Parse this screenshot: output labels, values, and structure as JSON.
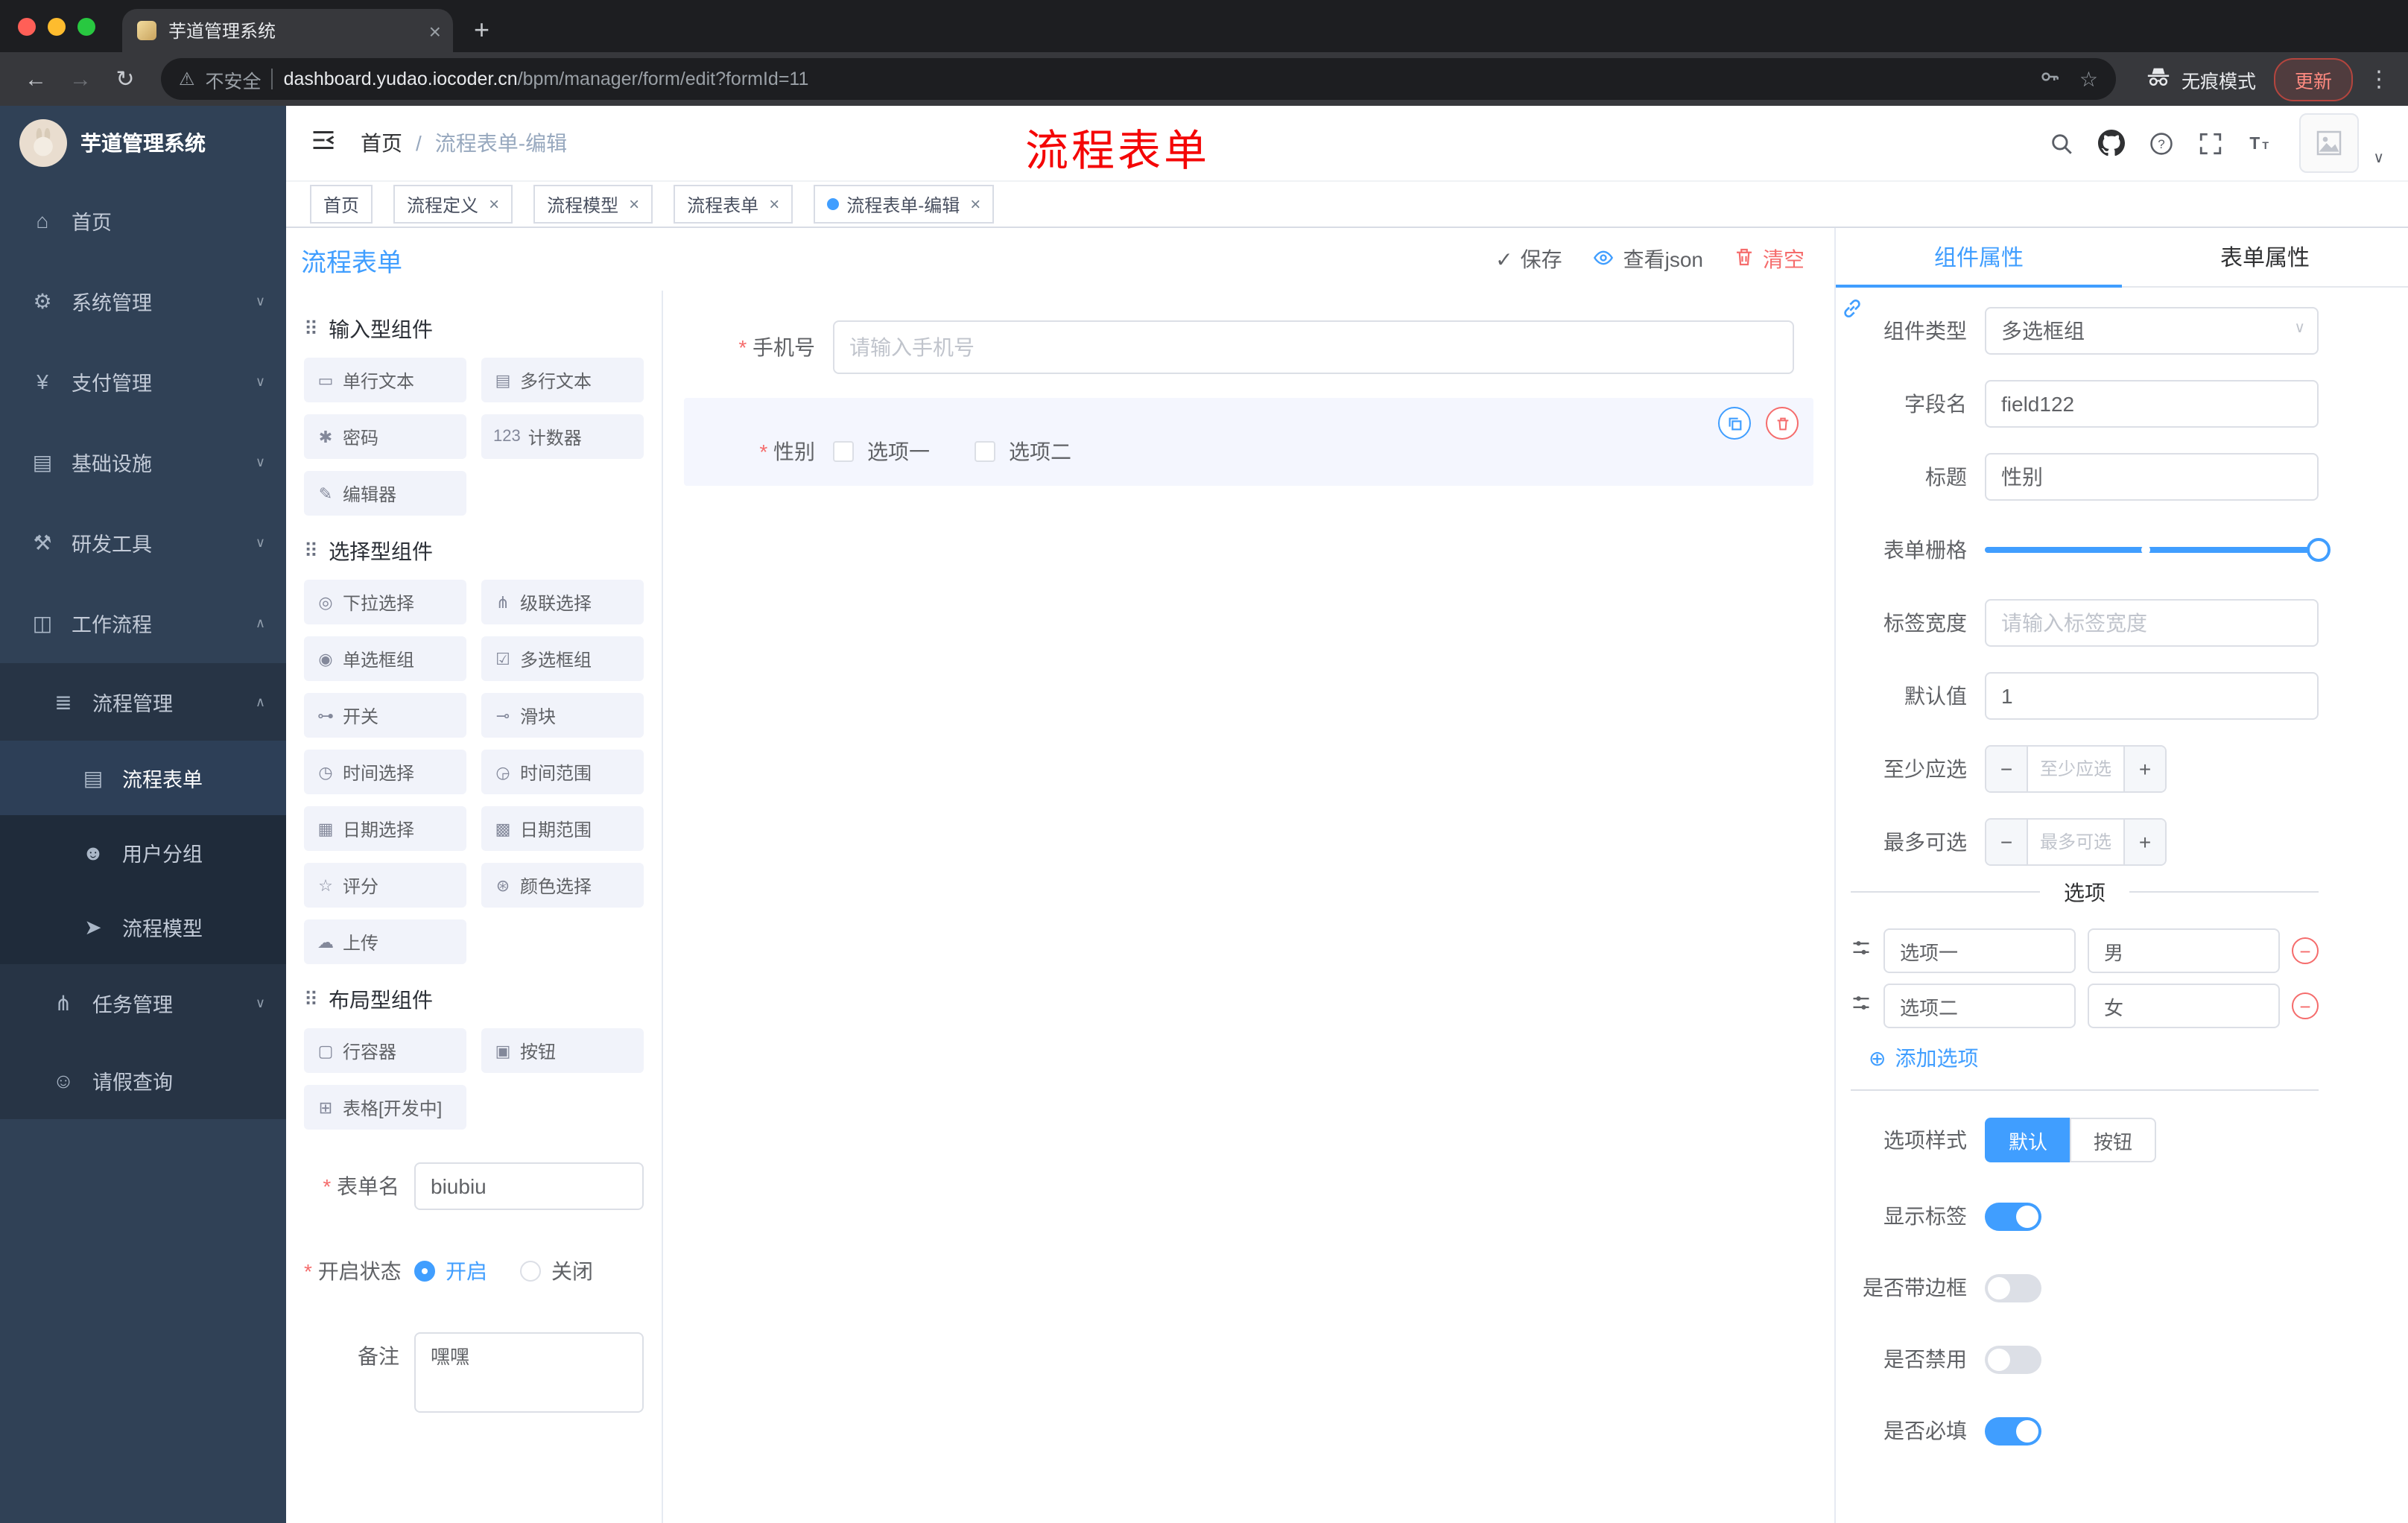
{
  "icons": {
    "chevron_down": "∨",
    "chevron_up": "∧",
    "close": "×",
    "plus": "+",
    "minus": "−",
    "warning": "⚠",
    "star_outline": "☆",
    "kebab": "⋮",
    "back_arrow": "←",
    "forward_arrow": "→",
    "reload": "↻",
    "check": "✓",
    "add_circle": "⊕",
    "grip": "⠿",
    "new_tab": "+"
  },
  "browser": {
    "tab_title": "芋道管理系统",
    "security_label": "不安全",
    "url_host": "dashboard.yudao.iocoder.cn",
    "url_path": "/bpm/manager/form/edit?formId=11",
    "incognito_label": "无痕模式",
    "update_label": "更新"
  },
  "sidebar": {
    "logo_title": "芋道管理系统",
    "items": [
      {
        "icon": "⌂",
        "label": "首页"
      },
      {
        "icon": "⚙",
        "label": "系统管理"
      },
      {
        "icon": "¥",
        "label": "支付管理"
      },
      {
        "icon": "▤",
        "label": "基础设施"
      },
      {
        "icon": "⚒",
        "label": "研发工具"
      },
      {
        "icon": "◫",
        "label": "工作流程"
      }
    ],
    "process_mgmt": {
      "icon": "≣",
      "label": "流程管理"
    },
    "process_children": [
      {
        "icon": "▤",
        "label": "流程表单"
      },
      {
        "icon": "☻",
        "label": "用户分组"
      },
      {
        "icon": "➤",
        "label": "流程模型"
      }
    ],
    "task_mgmt": {
      "icon": "⋔",
      "label": "任务管理"
    },
    "leave_query": {
      "icon": "☺",
      "label": "请假查询"
    }
  },
  "header": {
    "breadcrumb_home": "首页",
    "breadcrumb_sep": "/",
    "breadcrumb_current": "流程表单-编辑",
    "annotation": "流程表单"
  },
  "tags": [
    {
      "label": "首页"
    },
    {
      "label": "流程定义"
    },
    {
      "label": "流程模型"
    },
    {
      "label": "流程表单"
    },
    {
      "label": "流程表单-编辑"
    }
  ],
  "designer": {
    "panel_title": "流程表单",
    "save_label": "保存",
    "view_json_label": "查看json",
    "clear_label": "清空",
    "sections": [
      {
        "title": "输入型组件",
        "items": [
          {
            "icon": "▭",
            "label": "单行文本"
          },
          {
            "icon": "▤",
            "label": "多行文本"
          },
          {
            "icon": "✱",
            "label": "密码"
          },
          {
            "icon": "123",
            "label": "计数器"
          },
          {
            "icon": "✎",
            "label": "编辑器"
          }
        ]
      },
      {
        "title": "选择型组件",
        "items": [
          {
            "icon": "◎",
            "label": "下拉选择"
          },
          {
            "icon": "⋔",
            "label": "级联选择"
          },
          {
            "icon": "◉",
            "label": "单选框组"
          },
          {
            "icon": "☑",
            "label": "多选框组"
          },
          {
            "icon": "⊶",
            "label": "开关"
          },
          {
            "icon": "⊸",
            "label": "滑块"
          },
          {
            "icon": "◷",
            "label": "时间选择"
          },
          {
            "icon": "◶",
            "label": "时间范围"
          },
          {
            "icon": "▦",
            "label": "日期选择"
          },
          {
            "icon": "▩",
            "label": "日期范围"
          },
          {
            "icon": "☆",
            "label": "评分"
          },
          {
            "icon": "⊛",
            "label": "颜色选择"
          },
          {
            "icon": "☁",
            "label": "上传"
          }
        ]
      },
      {
        "title": "布局型组件",
        "items": [
          {
            "icon": "▢",
            "label": "行容器"
          },
          {
            "icon": "▣",
            "label": "按钮"
          },
          {
            "icon": "⊞",
            "label": "表格[开发中]"
          }
        ]
      }
    ],
    "form_name_label": "表单名",
    "form_name_value": "biubiu",
    "status_label": "开启状态",
    "status_on": "开启",
    "status_off": "关闭",
    "remark_label": "备注",
    "remark_value": "嘿嘿",
    "phone_label": "手机号",
    "phone_placeholder": "请输入手机号",
    "gender_label": "性别",
    "gender_option1": "选项一",
    "gender_option2": "选项二"
  },
  "inspector": {
    "tab_component": "组件属性",
    "tab_form": "表单属性",
    "component_type_label": "组件类型",
    "component_type_value": "多选框组",
    "field_name_label": "字段名",
    "field_name_value": "field122",
    "title_label": "标题",
    "title_value": "性别",
    "grid_label": "表单栅格",
    "label_width_label": "标签宽度",
    "label_width_placeholder": "请输入标签宽度",
    "default_label": "默认值",
    "default_value": "1",
    "min_label": "至少应选",
    "min_placeholder": "至少应选",
    "max_label": "最多可选",
    "max_placeholder": "最多可选",
    "options_title": "选项",
    "options": [
      {
        "label": "选项一",
        "value": "男"
      },
      {
        "label": "选项二",
        "value": "女"
      }
    ],
    "add_option_label": "添加选项",
    "style_label": "选项样式",
    "style_default": "默认",
    "style_button": "按钮",
    "show_label_label": "显示标签",
    "border_label": "是否带边框",
    "disabled_label": "是否禁用",
    "required_label": "是否必填"
  },
  "colors": {
    "primary": "#409eff",
    "danger": "#f56c6c",
    "annotation": "#f40606"
  }
}
